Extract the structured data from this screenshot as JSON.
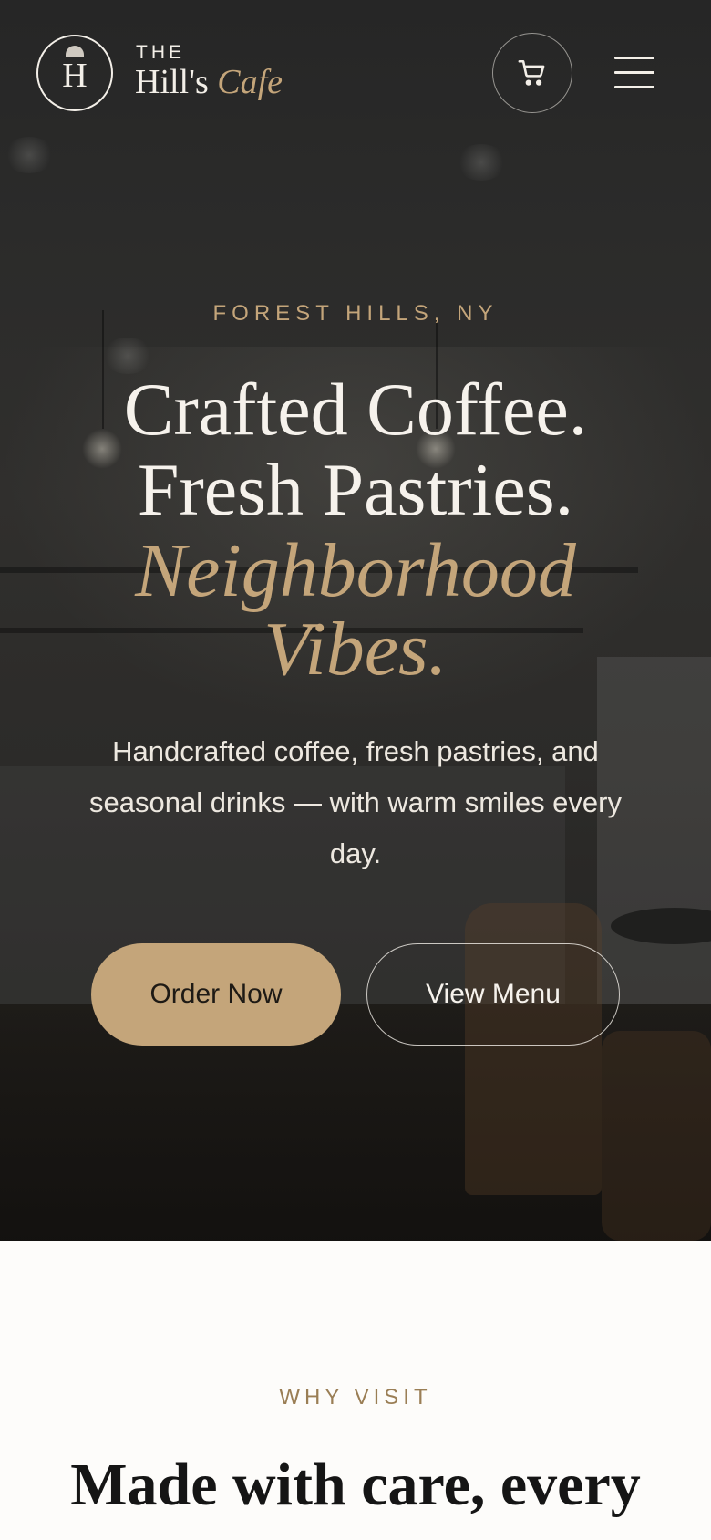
{
  "header": {
    "logo_letter": "H",
    "brand_the": "THE",
    "brand_name": "Hill's",
    "brand_cafe": "Cafe",
    "cart_icon": "shopping-cart-icon",
    "menu_icon": "hamburger-menu-icon"
  },
  "hero": {
    "location": "FOREST HILLS, NY",
    "headline_line1": "Crafted Coffee.",
    "headline_line2": "Fresh Pastries.",
    "headline_italic_line1": "Neighborhood",
    "headline_italic_line2": "Vibes.",
    "subtitle": "Handcrafted coffee, fresh pastries, and seasonal drinks — with warm smiles every day.",
    "order_button": "Order Now",
    "menu_button": "View Menu"
  },
  "why_visit": {
    "eyebrow": "WHY VISIT",
    "title": "Made with care, every"
  },
  "colors": {
    "accent": "#c4a57a",
    "hero_bg": "#2b2b2a",
    "text_light": "#f6f2ec",
    "page_bg": "#fdfcfa"
  }
}
